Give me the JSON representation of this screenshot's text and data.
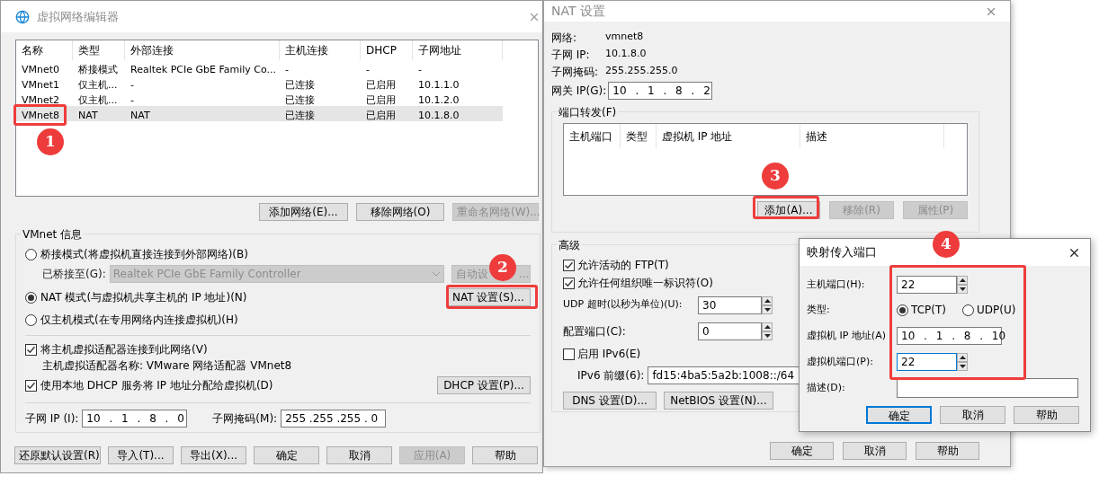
{
  "network_editor": {
    "title": "虚拟网络编辑器",
    "columns": [
      "名称",
      "类型",
      "外部连接",
      "主机连接",
      "DHCP",
      "子网地址"
    ],
    "rows": [
      {
        "cells": [
          "VMnet0",
          "桥接模式",
          "Realtek PCIe GbE Family Co...",
          "-",
          "-",
          "-"
        ],
        "selected": false
      },
      {
        "cells": [
          "VMnet1",
          "仅主机...",
          "-",
          "已连接",
          "已启用",
          "10.1.1.0"
        ],
        "selected": false
      },
      {
        "cells": [
          "VMnet2",
          "仅主机...",
          "-",
          "已连接",
          "已启用",
          "10.1.2.0"
        ],
        "selected": false
      },
      {
        "cells": [
          "VMnet8",
          "NAT",
          "NAT",
          "已连接",
          "已启用",
          "10.1.8.0"
        ],
        "selected": true
      }
    ],
    "list_buttons": [
      {
        "label": "添加网络(E)...",
        "disabled": false
      },
      {
        "label": "移除网络(O)",
        "disabled": false
      },
      {
        "label": "重命名网络(W)...",
        "disabled": true
      }
    ],
    "info": {
      "title": "VMnet 信息",
      "modes": [
        {
          "label": "桥接模式(将虚拟机直接连接到外部网络)(B)",
          "selected": false
        },
        {
          "label": "NAT 模式(与虚拟机共享主机的 IP 地址)(N)",
          "selected": true
        },
        {
          "label": "仅主机模式(在专用网络内连接虚拟机)(H)",
          "selected": false
        }
      ],
      "bridged_to": {
        "label": "已桥接至(G):",
        "value": "Realtek PCIe GbE Family Controller",
        "disabled": true
      },
      "auto_button": {
        "label_parts": [
          "自动设",
          "..."
        ],
        "disabled": true
      },
      "nat_button": {
        "label": "NAT 设置(S)...",
        "disabled": false
      },
      "adapter_checkbox": {
        "label": "将主机虚拟适配器连接到此网络(V)",
        "checked": true
      },
      "adapter_name": "主机虚拟适配器名称: VMware 网络适配器 VMnet8",
      "dhcp_checkbox": {
        "label": "使用本地 DHCP 服务将 IP 地址分配给虚拟机(D)",
        "checked": true
      },
      "dhcp_button": {
        "label": "DHCP 设置(P)...",
        "disabled": false
      },
      "subnet_ip": {
        "label": "子网 IP (I):",
        "value": "10 . 1 . 8 . 0"
      },
      "subnet_mask": {
        "label": "子网掩码(M):",
        "value": "255 .255 .255 . 0"
      }
    },
    "footer_buttons": [
      {
        "label": "还原默认设置(R)",
        "disabled": false
      },
      {
        "label": "导入(T)...",
        "disabled": false
      },
      {
        "label": "导出(X)...",
        "disabled": false
      },
      {
        "label": "确定",
        "disabled": false
      },
      {
        "label": "取消",
        "disabled": false
      },
      {
        "label": "应用(A)",
        "disabled": true
      },
      {
        "label": "帮助",
        "disabled": false
      }
    ]
  },
  "nat_settings": {
    "title": "NAT 设置",
    "info": [
      {
        "label": "网络:",
        "value": "vmnet8"
      },
      {
        "label": "子网 IP:",
        "value": "10.1.8.0"
      },
      {
        "label": "子网掩码:",
        "value": "255.255.255.0"
      }
    ],
    "gateway": {
      "label": "网关 IP(G):",
      "value": "10 . 1 . 8 . 2"
    },
    "port_forwarding": {
      "title": "端口转发(F)",
      "columns": [
        "主机端口",
        "类型",
        "虚拟机 IP 地址",
        "描述"
      ],
      "buttons": [
        {
          "label": "添加(A)...",
          "disabled": false
        },
        {
          "label": "移除(R)",
          "disabled": true
        },
        {
          "label": "属性(P)",
          "disabled": true
        }
      ]
    },
    "advanced": {
      "title": "高级",
      "checkboxes": [
        {
          "label": "允许活动的 FTP(T)",
          "checked": true
        },
        {
          "label": "允许任何组织唯一标识符(O)",
          "checked": true
        }
      ],
      "udp_timeout": {
        "label": "UDP 超时(以秒为单位)(U):",
        "value": "30"
      },
      "config_port": {
        "label": "配置端口(C):",
        "value": "0"
      },
      "ipv6": {
        "label": "启用 IPv6(E)",
        "checked": false
      },
      "ipv6_prefix": {
        "label": "IPv6 前缀(6):",
        "value": "fd15:4ba5:5a2b:1008::/64"
      },
      "buttons": [
        "DNS 设置(D)...",
        "NetBIOS 设置(N)..."
      ]
    },
    "footer_buttons": [
      "确定",
      "取消",
      "帮助"
    ]
  },
  "port_dialog": {
    "title": "映射传入端口",
    "host_port": {
      "label": "主机端口(H):",
      "value": "22"
    },
    "type": {
      "label": "类型:",
      "options": [
        {
          "label": "TCP(T)",
          "selected": true
        },
        {
          "label": "UDP(U)",
          "selected": false
        }
      ]
    },
    "vm_ip": {
      "label": "虚拟机 IP 地址(A)",
      "value": "10 . 1 . 8 . 10"
    },
    "vm_port": {
      "label": "虚拟机端口(P):",
      "value": "22",
      "focused": true
    },
    "description": {
      "label": "描述(D):"
    },
    "buttons": [
      {
        "label": "确定",
        "default": true
      },
      {
        "label": "取消",
        "default": false
      },
      {
        "label": "帮助",
        "default": false
      }
    ]
  },
  "annotations": [
    {
      "label": "1"
    },
    {
      "label": "2"
    },
    {
      "label": "3"
    },
    {
      "label": "4"
    }
  ]
}
